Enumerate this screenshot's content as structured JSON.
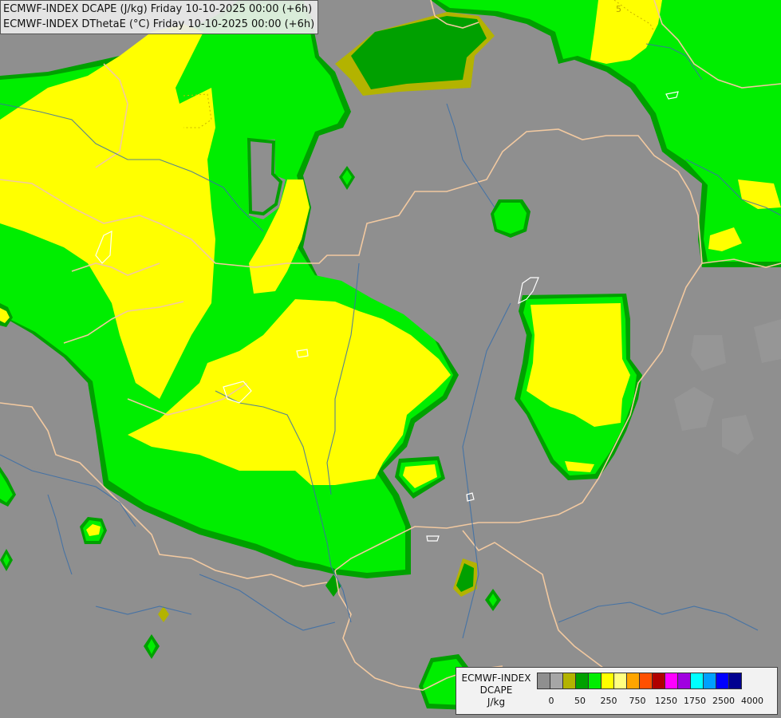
{
  "header": {
    "line1": "ECMWF-INDEX DCAPE (J/kg) Friday 10-10-2025 00:00 (+6h)",
    "line2": "ECMWF-INDEX DThetaE (°C) Friday 10-10-2025 00:00 (+6h)"
  },
  "map": {
    "contour_label": "5"
  },
  "legend": {
    "source": "ECMWF-INDEX",
    "parameter": "DCAPE",
    "unit": "J/kg",
    "colors": [
      "#8f8f8f",
      "#a6a6a6",
      "#b3b300",
      "#00a000",
      "#00ee00",
      "#ffff00",
      "#ffff80",
      "#ffa500",
      "#ff5000",
      "#b00000",
      "#ff00ff",
      "#a000e0",
      "#00ffff",
      "#00a0ff",
      "#0000ff",
      "#000090"
    ],
    "tick_labels": [
      {
        "text": "0",
        "index": 1
      },
      {
        "text": "50",
        "index": 3
      },
      {
        "text": "250",
        "index": 5
      },
      {
        "text": "750",
        "index": 7
      },
      {
        "text": "1250",
        "index": 9
      },
      {
        "text": "1750",
        "index": 11
      },
      {
        "text": "2500",
        "index": 13
      },
      {
        "text": "4000",
        "index": 15
      }
    ]
  }
}
